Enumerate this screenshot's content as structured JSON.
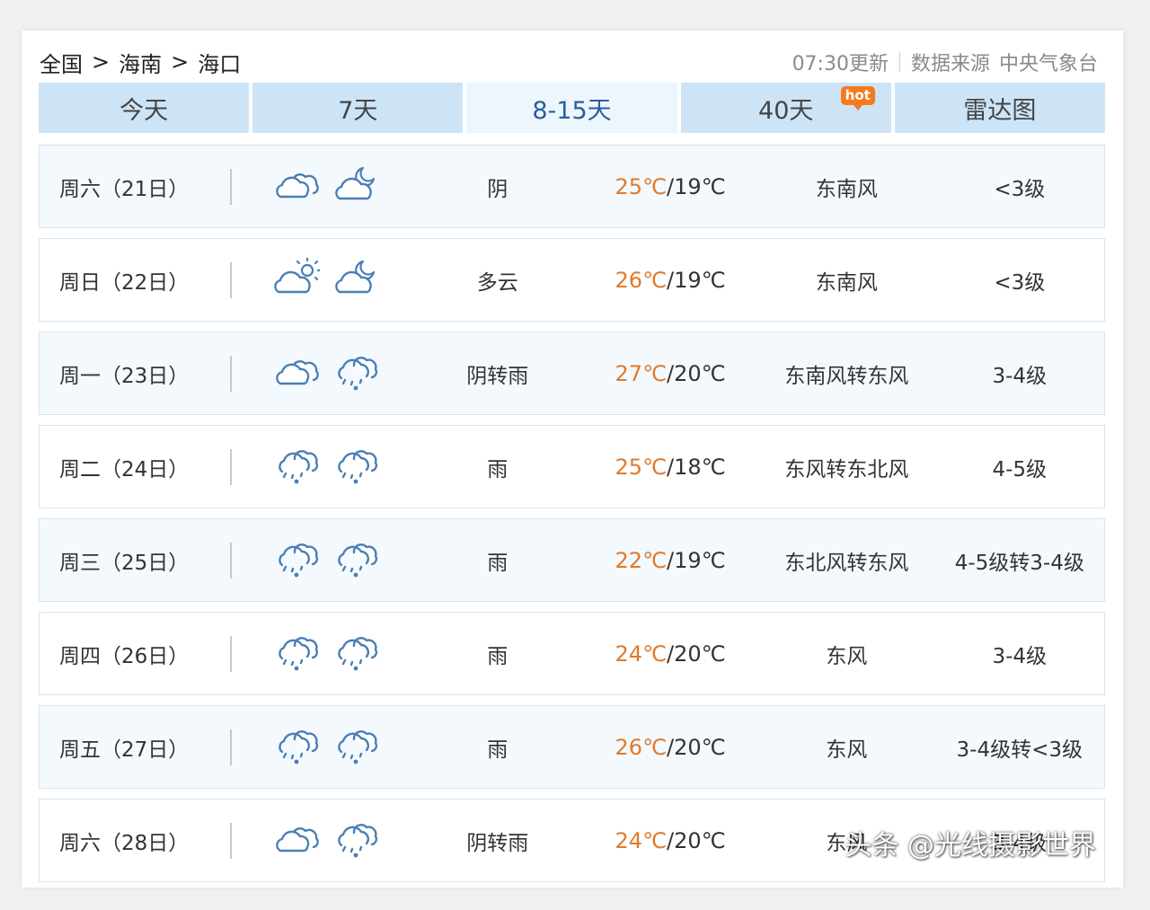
{
  "breadcrumb": {
    "items": [
      "全国",
      "海南",
      "海口"
    ],
    "separator": ">"
  },
  "meta": {
    "updated": "07:30更新",
    "source_label": "数据来源",
    "source_name": "中央气象台"
  },
  "tabs": [
    {
      "label": "今天",
      "active": false
    },
    {
      "label": "7天",
      "active": false
    },
    {
      "label": "8-15天",
      "active": true
    },
    {
      "label": "40天",
      "active": false,
      "badge": "hot"
    },
    {
      "label": "雷达图",
      "active": false
    }
  ],
  "forecast": [
    {
      "date": "周六（21日）",
      "day_icon": "cloudy-icon",
      "night_icon": "partly-cloudy-night-icon",
      "condition": "阴",
      "high": "25℃",
      "low": "19℃",
      "wind": "东南风",
      "level": "<3级"
    },
    {
      "date": "周日（22日）",
      "day_icon": "partly-cloudy-day-icon",
      "night_icon": "partly-cloudy-night-icon",
      "condition": "多云",
      "high": "26℃",
      "low": "19℃",
      "wind": "东南风",
      "level": "<3级"
    },
    {
      "date": "周一（23日）",
      "day_icon": "cloudy-icon",
      "night_icon": "rain-icon",
      "condition": "阴转雨",
      "high": "27℃",
      "low": "20℃",
      "wind": "东南风转东风",
      "level": "3-4级"
    },
    {
      "date": "周二（24日）",
      "day_icon": "rain-icon",
      "night_icon": "rain-icon",
      "condition": "雨",
      "high": "25℃",
      "low": "18℃",
      "wind": "东风转东北风",
      "level": "4-5级"
    },
    {
      "date": "周三（25日）",
      "day_icon": "rain-icon",
      "night_icon": "rain-icon",
      "condition": "雨",
      "high": "22℃",
      "low": "19℃",
      "wind": "东北风转东风",
      "level": "4-5级转3-4级"
    },
    {
      "date": "周四（26日）",
      "day_icon": "rain-icon",
      "night_icon": "rain-icon",
      "condition": "雨",
      "high": "24℃",
      "low": "20℃",
      "wind": "东风",
      "level": "3-4级"
    },
    {
      "date": "周五（27日）",
      "day_icon": "rain-icon",
      "night_icon": "rain-icon",
      "condition": "雨",
      "high": "26℃",
      "low": "20℃",
      "wind": "东风",
      "level": "3-4级转<3级"
    },
    {
      "date": "周六（28日）",
      "day_icon": "cloudy-icon",
      "night_icon": "rain-icon",
      "condition": "阴转雨",
      "high": "24℃",
      "low": "20℃",
      "wind": "东风",
      "level": "3-4级"
    }
  ],
  "watermark": "头条 @光线摄影世界",
  "colors": {
    "tab_bg": "#cde4f7",
    "tab_active_bg": "#eef6fd",
    "tab_active_text": "#2a5e9e",
    "high_temp": "#e07a2a",
    "icon_stroke": "#4a7fb5",
    "hot_badge": "#f37a1f"
  }
}
